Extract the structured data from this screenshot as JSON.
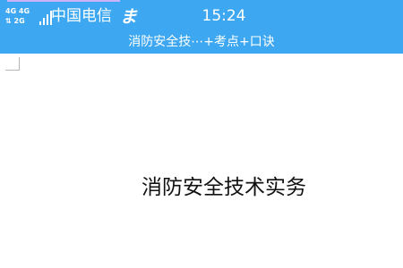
{
  "status_bar": {
    "signal_row_1": "4G 4G",
    "signal_row_2": "2G",
    "signal_icon": "cellular-signal-icon",
    "carrier": "中国电信",
    "carrier_logo_glyph": "ま",
    "time": "15:24"
  },
  "app_header": {
    "document_title": "消防安全技⋯+考点+口诀"
  },
  "document": {
    "heading": "消防安全技术实务"
  },
  "colors": {
    "header_background": "#3ea7f1",
    "header_text": "#ffffff",
    "page_background": "#ffffff",
    "heading_text": "#111111"
  }
}
